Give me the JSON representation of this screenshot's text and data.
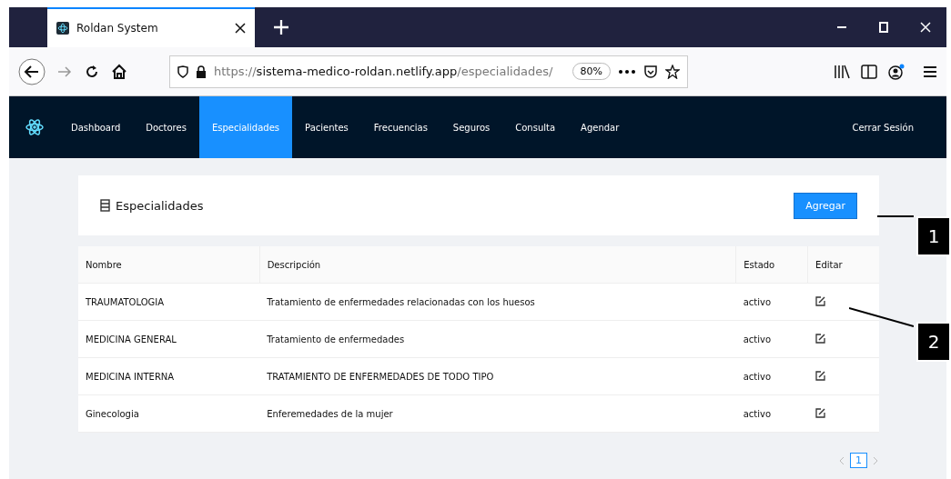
{
  "browser": {
    "tab_title": "Roldan System",
    "url": {
      "scheme": "https://",
      "host": "sistema-medico-roldan.netlify.app",
      "path": "/especialidades/"
    },
    "zoom": "80%"
  },
  "navbar": {
    "items": [
      {
        "label": "Dashboard",
        "selected": false
      },
      {
        "label": "Doctores",
        "selected": false
      },
      {
        "label": "Especialidades",
        "selected": true
      },
      {
        "label": "Pacientes",
        "selected": false
      },
      {
        "label": "Frecuencias",
        "selected": false
      },
      {
        "label": "Seguros",
        "selected": false
      },
      {
        "label": "Consulta",
        "selected": false
      },
      {
        "label": "Agendar",
        "selected": false
      }
    ],
    "logout": "Cerrar Sesión"
  },
  "card": {
    "title": "Especialidades",
    "button": "Agregar"
  },
  "table": {
    "columns": [
      "Nombre",
      "Descripción",
      "Estado",
      "Editar"
    ],
    "rows": [
      {
        "nombre": "TRAUMATOLOGIA",
        "descripcion": "Tratamiento de enfermedades relacionadas con los huesos",
        "estado": "activo"
      },
      {
        "nombre": "MEDICINA GENERAL",
        "descripcion": "Tratamiento de enfermedades",
        "estado": "activo"
      },
      {
        "nombre": "MEDICINA INTERNA",
        "descripcion": "TRATAMIENTO DE ENFERMEDADES DE TODO TIPO",
        "estado": "activo"
      },
      {
        "nombre": "Ginecologia",
        "descripcion": "Enferemedades de la mujer",
        "estado": "activo"
      }
    ]
  },
  "pagination": {
    "pages": [
      {
        "label": "1",
        "selected": true
      }
    ]
  },
  "callouts": [
    "1",
    "2"
  ]
}
